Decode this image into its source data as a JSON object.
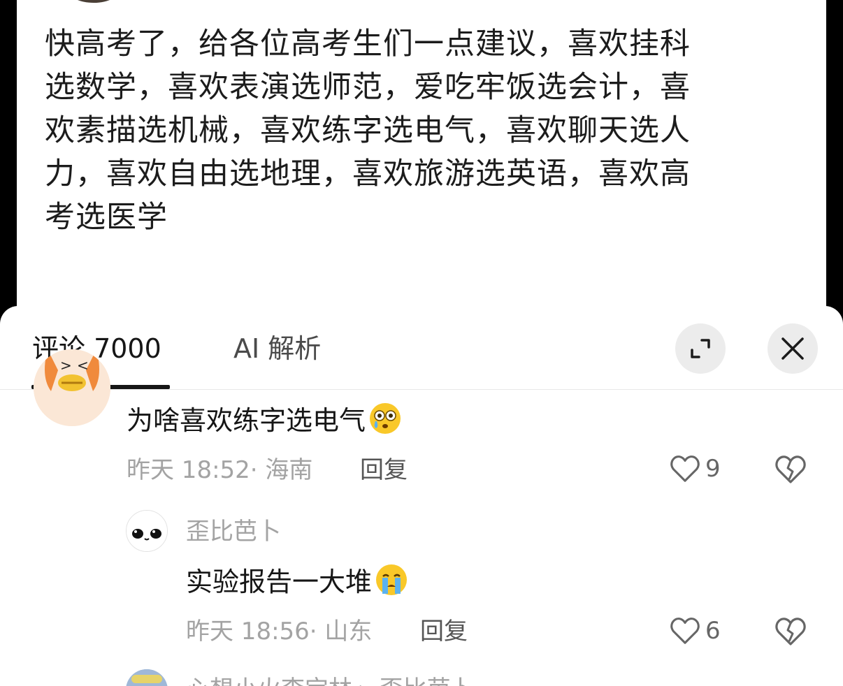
{
  "post": {
    "text": "快高考了，给各位高考生们一点建议，喜欢挂科选数学，喜欢表演选师范，爱吃牢饭选会计，喜欢素描选机械，喜欢练字选电气，喜欢聊天选人力，喜欢自由选地理，喜欢旅游选英语，喜欢高考选医学"
  },
  "sheet": {
    "tabs": [
      {
        "label": "评论 7000",
        "active": true
      },
      {
        "label": "AI 解析",
        "active": false
      }
    ],
    "expand_icon": "expand-icon",
    "close_icon": "close-icon"
  },
  "comments": [
    {
      "text": "为啥喜欢练字选电气",
      "emoji": "astonished-tear-emoji",
      "meta": "昨天 18:52· 海南",
      "reply_label": "回复",
      "likes": "9"
    },
    {
      "username": "歪比芭卜",
      "text": "实验报告一大堆",
      "emoji": "crying-emoji",
      "meta": "昨天 18:56· 山东",
      "reply_label": "回复",
      "likes": "6"
    },
    {
      "username": "心想小火李宝林 ▸ 歪比芭卜"
    }
  ],
  "colors": {
    "accent": "#161616",
    "muted": "#a3a3a3",
    "button_bg": "#ececec"
  }
}
